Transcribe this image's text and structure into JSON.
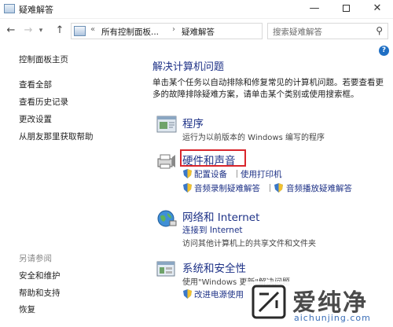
{
  "window": {
    "title": "疑难解答",
    "controls": {
      "minimize": "—",
      "close": "✕"
    }
  },
  "nav": {
    "back": "←",
    "forward": "→",
    "up": "↑",
    "address": {
      "prefix": "«",
      "crumb1": "所有控制面板...",
      "sep": "›",
      "crumb2": "疑难解答"
    },
    "search_placeholder": "搜索疑难解答"
  },
  "sidebar": {
    "home": "控制面板主页",
    "items": [
      "查看全部",
      "查看历史记录",
      "更改设置",
      "从朋友那里获取帮助"
    ],
    "see_also_heading": "另请参阅",
    "see_also": [
      "安全和维护",
      "帮助和支持",
      "恢复"
    ]
  },
  "main": {
    "title": "解决计算机问题",
    "description_line1": "单击某个任务以自动排除和修复常见的计算机问题。若要查看更",
    "description_line2": "多的故障排除疑难方案，请单击某个类别或使用搜索框。",
    "categories": [
      {
        "title": "程序",
        "desc": "运行为以前版本的 Windows 编写的程序"
      },
      {
        "title": "硬件和声音",
        "links": [
          "配置设备",
          "使用打印机",
          "音频录制疑难解答",
          "音频播放疑难解答"
        ]
      },
      {
        "title": "网络和 Internet",
        "links": [
          "连接到 Internet"
        ],
        "desc": "访问其他计算机上的共享文件和文件夹"
      },
      {
        "title": "系统和安全性",
        "desc": "使用\"Windows 更新\"解决问题",
        "links": [
          "改进电源使用"
        ]
      }
    ]
  },
  "watermark": {
    "brand": "爱纯净",
    "url": "aichunjing.com"
  },
  "colors": {
    "link": "#1e3287",
    "highlight": "#d9262c",
    "help": "#1f6fc4"
  }
}
